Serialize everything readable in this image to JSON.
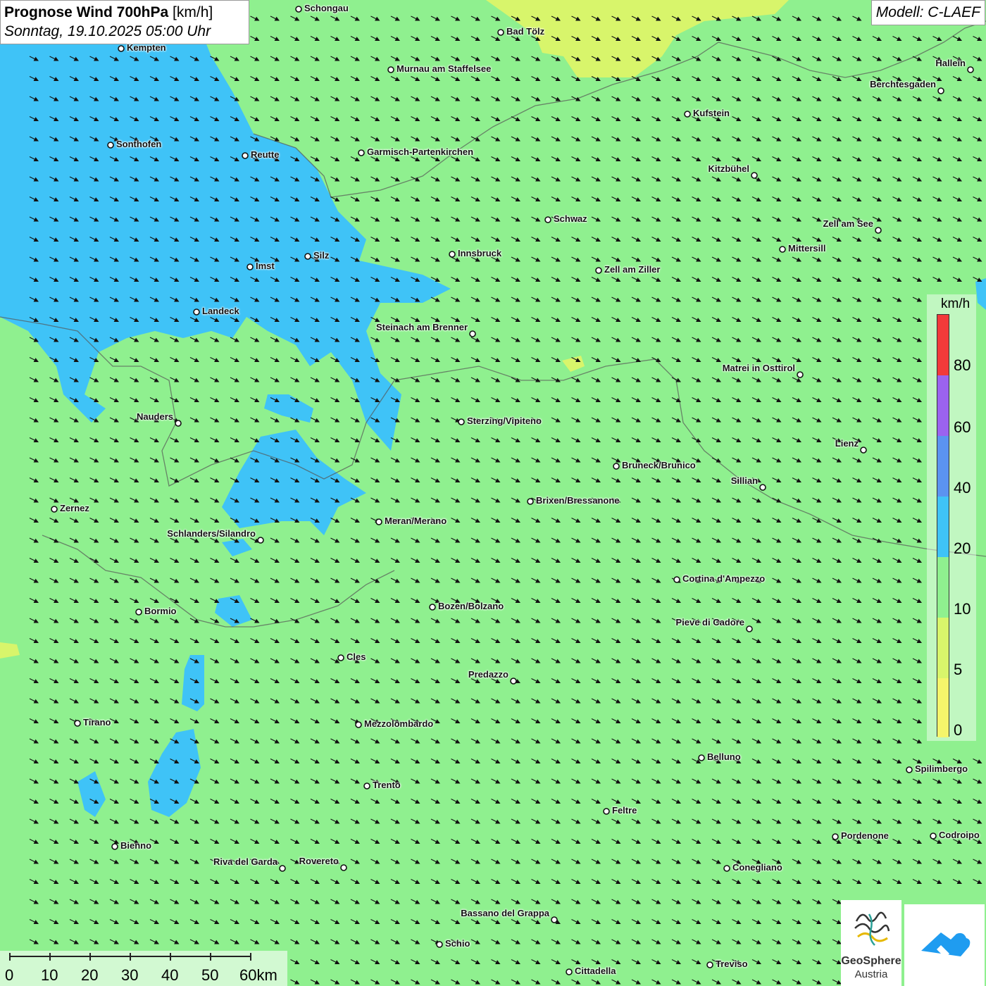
{
  "title": {
    "main_bold": "Prognose Wind 700hPa",
    "main_unit": "[km/h]",
    "subtitle": "Sonntag, 19.10.2025 05:00 Uhr"
  },
  "model": "Modell: C-LAEF",
  "legend": {
    "unit": "km/h",
    "labels": [
      "80",
      "60",
      "40",
      "20",
      "10",
      "5",
      "0"
    ],
    "colors": {
      "0-5": "#f5f56b",
      "5-10": "#d8f56b",
      "10-20": "#8ff08f",
      "20-40": "#3fc3f7",
      "40-60": "#5b93f0",
      "60-80": "#9b63ef",
      "80+": "#f23a3a"
    }
  },
  "map": {
    "wind_direction": "north-west",
    "cities": [
      {
        "name": "Schongau"
      },
      {
        "name": "Bad Tölz"
      },
      {
        "name": "Kempten"
      },
      {
        "name": "Murnau am Staffelsee"
      },
      {
        "name": "Hallein"
      },
      {
        "name": "Berchtesgaden"
      },
      {
        "name": "Kufstein"
      },
      {
        "name": "Sonthofen"
      },
      {
        "name": "Reutte"
      },
      {
        "name": "Garmisch-Partenkirchen"
      },
      {
        "name": "Kitzbühel"
      },
      {
        "name": "Schwaz"
      },
      {
        "name": "Zell am See"
      },
      {
        "name": "Innsbruck"
      },
      {
        "name": "Mittersill"
      },
      {
        "name": "Silz"
      },
      {
        "name": "Imst"
      },
      {
        "name": "Zell am Ziller"
      },
      {
        "name": "Landeck"
      },
      {
        "name": "Steinach am Brenner"
      },
      {
        "name": "Matrei in Osttirol"
      },
      {
        "name": "Nauders"
      },
      {
        "name": "Sterzing/Vipiteno"
      },
      {
        "name": "Lienz"
      },
      {
        "name": "Bruneck/Brunico"
      },
      {
        "name": "Sillian"
      },
      {
        "name": "Zernez"
      },
      {
        "name": "Brixen/Bressanone"
      },
      {
        "name": "Meran/Merano"
      },
      {
        "name": "Schlanders/Silandro"
      },
      {
        "name": "Cortina d'Ampezzo"
      },
      {
        "name": "Bormio"
      },
      {
        "name": "Bozen/Bolzano"
      },
      {
        "name": "Pieve di Cadore"
      },
      {
        "name": "Cles"
      },
      {
        "name": "Predazzo"
      },
      {
        "name": "Tirano"
      },
      {
        "name": "Mezzolombardo"
      },
      {
        "name": "Belluno"
      },
      {
        "name": "Spilimbergo"
      },
      {
        "name": "Trento"
      },
      {
        "name": "Feltre"
      },
      {
        "name": "Bienno"
      },
      {
        "name": "Pordenone"
      },
      {
        "name": "Codroipo"
      },
      {
        "name": "Riva del Garda"
      },
      {
        "name": "Rovereto"
      },
      {
        "name": "Conegliano"
      },
      {
        "name": "Bassano del Grappa"
      },
      {
        "name": "Schio"
      },
      {
        "name": "Treviso"
      },
      {
        "name": "Cittadella"
      }
    ]
  },
  "scale_bar": {
    "labels": [
      "0",
      "10",
      "20",
      "30",
      "40",
      "50",
      "60km"
    ]
  },
  "logos": {
    "geosphere_line1": "GeoSphere",
    "geosphere_line2": "Austria"
  }
}
